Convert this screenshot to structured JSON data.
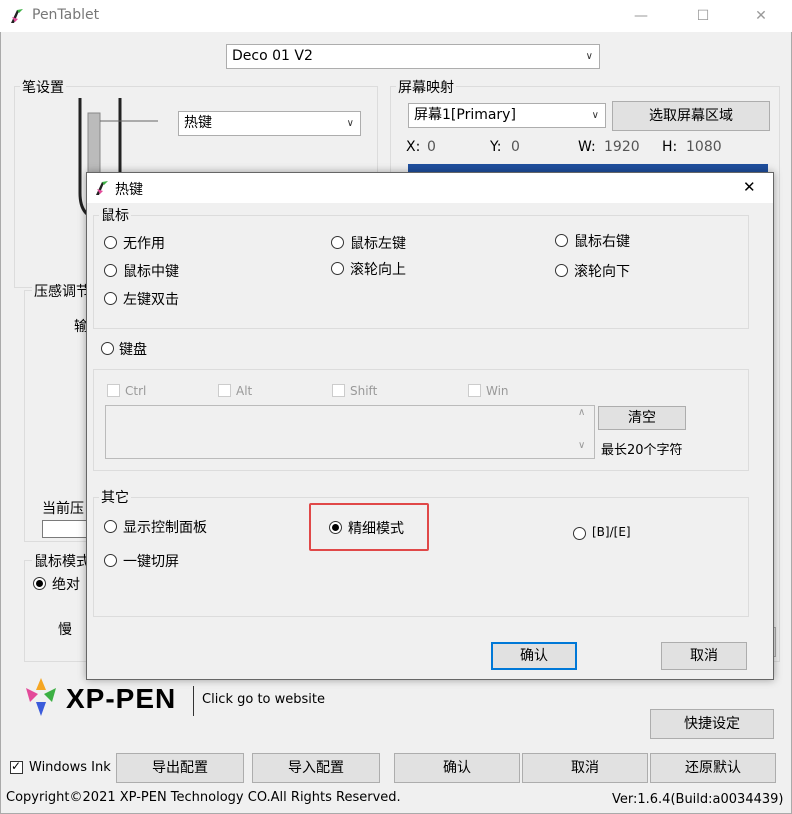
{
  "window": {
    "title": "PenTablet",
    "minimize": "—",
    "maximize": "☐",
    "close": "✕"
  },
  "device_select": {
    "value": "Deco 01 V2"
  },
  "pen_settings": {
    "label": "笔设置",
    "button_select": "热键"
  },
  "pressure": {
    "label": "压感调节",
    "output_partial": "输",
    "current_partial": "当前压"
  },
  "mouse_mode": {
    "label": "鼠标模式",
    "absolute_partial": "绝对",
    "slow": "慢"
  },
  "screen_mapping": {
    "label": "屏幕映射",
    "screen_select": "屏幕1[Primary]",
    "select_area_button": "选取屏幕区域",
    "x_label": "X:",
    "x_value": "0",
    "y_label": "Y:",
    "y_value": "0",
    "w_label": "W:",
    "w_value": "1920",
    "h_label": "H:",
    "h_value": "1080"
  },
  "logo": {
    "brand": "XP-PEN",
    "link": "Click go to website"
  },
  "buttons": {
    "shortcut_settings": "快捷设定",
    "export": "导出配置",
    "import": "导入配置",
    "ok": "确认",
    "cancel": "取消",
    "restore": "还原默认"
  },
  "windows_ink": {
    "label": "Windows Ink",
    "checked": true
  },
  "footer": {
    "copyright": "Copyright©2021 XP-PEN Technology CO.All Rights Reserved.",
    "version": "Ver:1.6.4(Build:a0034439)"
  },
  "dialog": {
    "title": "热键",
    "close": "✕",
    "mouse_group": "鼠标",
    "mouse_options": {
      "none": "无作用",
      "left": "鼠标左键",
      "right": "鼠标右键",
      "middle": "鼠标中键",
      "wheel_up": "滚轮向上",
      "wheel_down": "滚轮向下",
      "double_click": "左键双击"
    },
    "keyboard": "键盘",
    "modifiers": {
      "ctrl": "Ctrl",
      "alt": "Alt",
      "shift": "Shift",
      "win": "Win"
    },
    "clear_button": "清空",
    "max_chars": "最长20个字符",
    "other_group": "其它",
    "other_options": {
      "show_panel": "显示控制面板",
      "fine_mode": "精细模式",
      "be": "[B]/[E]",
      "switch_screen": "一键切屏"
    },
    "ok": "确认",
    "cancel": "取消"
  }
}
